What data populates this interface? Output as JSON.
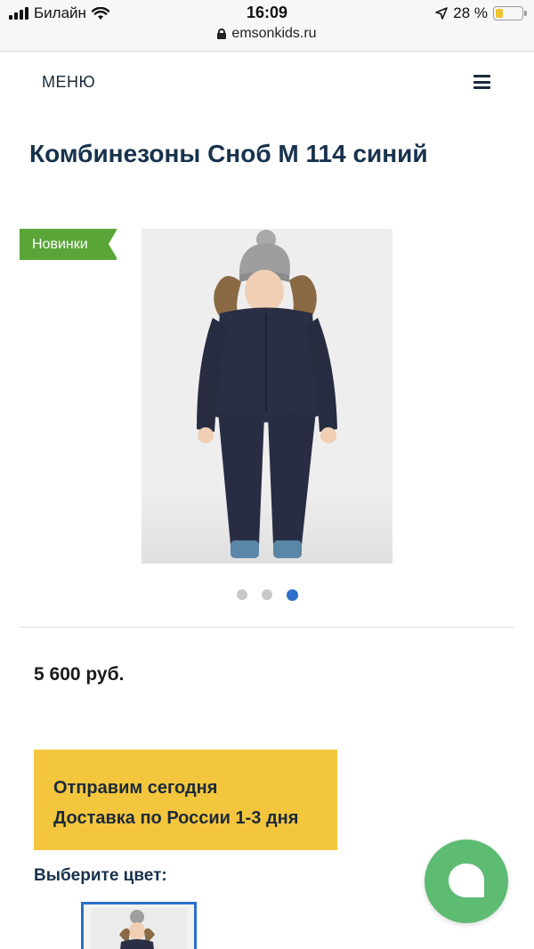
{
  "status_bar": {
    "carrier": "Билайн",
    "time": "16:09",
    "battery": "28 %",
    "battery_level": 0.28,
    "url": "emsonkids.ru"
  },
  "header": {
    "menu_label": "МЕНЮ",
    "menu_icon": "hamburger-icon"
  },
  "product": {
    "title": "Комбинезоны Сноб М 114 синий",
    "badge": "Новинки",
    "price": "5 600 руб.",
    "gallery": {
      "count": 3,
      "active_index": 2
    }
  },
  "delivery": {
    "line1": "Отправим сегодня",
    "line2": "Доставка по России 1-3 дня"
  },
  "color_select": {
    "label": "Выберите цвет:"
  },
  "colors": {
    "badge_green": "#5aa537",
    "delivery_yellow": "#f4c63d",
    "accent_blue": "#2c6fc9",
    "chat_green": "#5dbb72",
    "title_navy": "#17324d"
  },
  "icons": {
    "chat": "chat-bubble-icon",
    "lock": "lock-icon",
    "location": "location-arrow-icon",
    "wifi": "wifi-icon",
    "signal": "signal-icon"
  }
}
